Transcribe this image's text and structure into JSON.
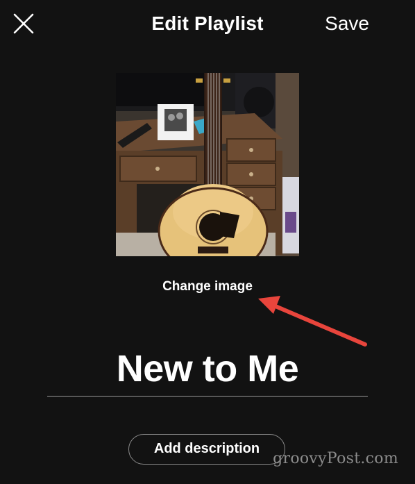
{
  "header": {
    "title": "Edit Playlist",
    "save_label": "Save",
    "close_icon": "close-icon"
  },
  "cover": {
    "description_icon": "playlist-cover-image"
  },
  "change_image_label": "Change image",
  "playlist_name": "New to Me",
  "add_description_label": "Add description",
  "watermark": "groovyPost.com",
  "colors": {
    "background": "#121212",
    "text": "#ffffff",
    "annotation_arrow": "#e8453c",
    "button_border": "#8a8a8a",
    "watermark": "#8c8c8c"
  }
}
